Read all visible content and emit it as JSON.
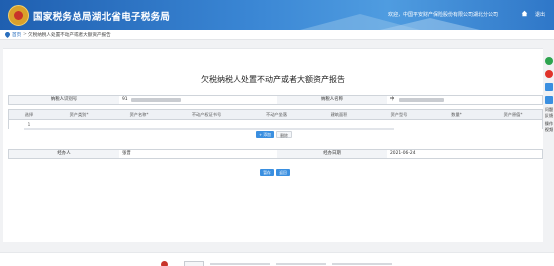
{
  "header": {
    "site_title": "国家税务总局湖北省电子税务局",
    "welcome_text": "欢迎，中国平安财产保险股份有限公司湖北分公司",
    "exit_label": "退出"
  },
  "breadcrumb": {
    "home": "首页",
    "separator": ">",
    "current": "欠税纳税人处置不动产或者大额资产报告"
  },
  "form": {
    "title": "欠税纳税人处置不动产或者大额资产报告",
    "taxpayer_id_label": "纳税人识别号",
    "taxpayer_id_value": "91",
    "taxpayer_name_label": "纳税人名称",
    "taxpayer_name_value": "中",
    "grid_headers": [
      "选择",
      "资产类别*",
      "资产名称*",
      "不动产权证书号",
      "不动产坐落",
      "建筑面积",
      "资产型号",
      "数量*",
      "资产原值*"
    ],
    "grid_row_index": "1",
    "add_label": "+ 添加",
    "delete_label": "删除",
    "handler_label": "经办人",
    "handler_value": "张晋",
    "handle_date_label": "经办日期",
    "handle_date_value": "2021-06-24",
    "save_label": "暂存",
    "return_label": "返回"
  },
  "sidebar": {
    "items": [
      "问题",
      "反馈",
      "操作",
      "视频"
    ]
  },
  "colors": {
    "header_blue": "#2a6fbe",
    "button_blue": "#3a8fe0",
    "green": "#2ea44f",
    "red": "#e0332a"
  }
}
